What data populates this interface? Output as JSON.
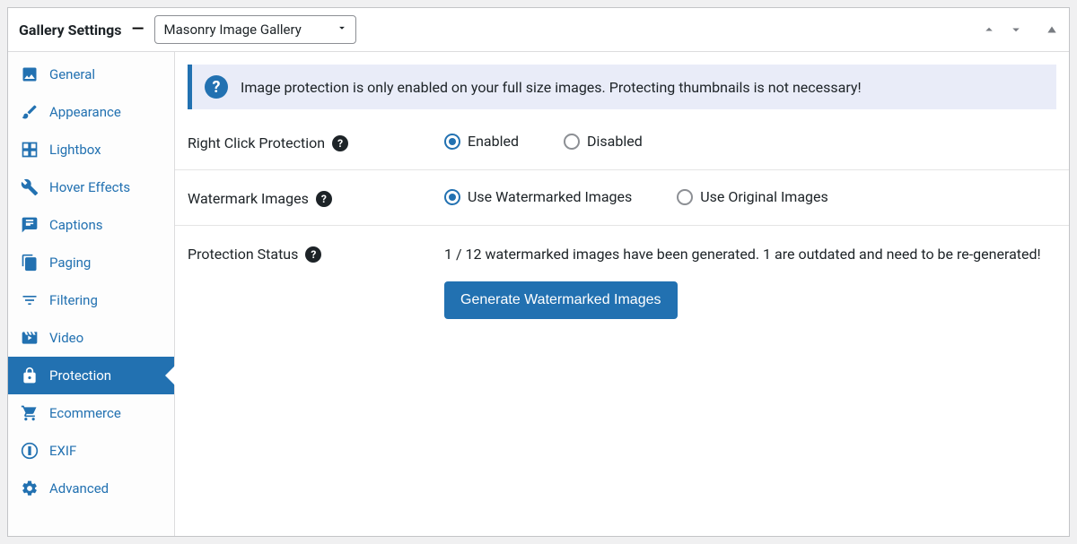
{
  "header": {
    "title": "Gallery Settings",
    "gallery_type": "Masonry Image Gallery"
  },
  "sidebar": {
    "items": [
      {
        "label": "General"
      },
      {
        "label": "Appearance"
      },
      {
        "label": "Lightbox"
      },
      {
        "label": "Hover Effects"
      },
      {
        "label": "Captions"
      },
      {
        "label": "Paging"
      },
      {
        "label": "Filtering"
      },
      {
        "label": "Video"
      },
      {
        "label": "Protection"
      },
      {
        "label": "Ecommerce"
      },
      {
        "label": "EXIF"
      },
      {
        "label": "Advanced"
      }
    ],
    "active_index": 8
  },
  "notice": {
    "text": "Image protection is only enabled on your full size images. Protecting thumbnails is not necessary!"
  },
  "settings": {
    "right_click": {
      "label": "Right Click Protection",
      "options": {
        "enabled": "Enabled",
        "disabled": "Disabled"
      },
      "value": "enabled"
    },
    "watermark": {
      "label": "Watermark Images",
      "options": {
        "use": "Use Watermarked Images",
        "orig": "Use Original Images"
      },
      "value": "use"
    },
    "status": {
      "label": "Protection Status",
      "text": "1 / 12 watermarked images have been generated. 1 are outdated and need to be re-generated!",
      "button": "Generate Watermarked Images"
    }
  }
}
